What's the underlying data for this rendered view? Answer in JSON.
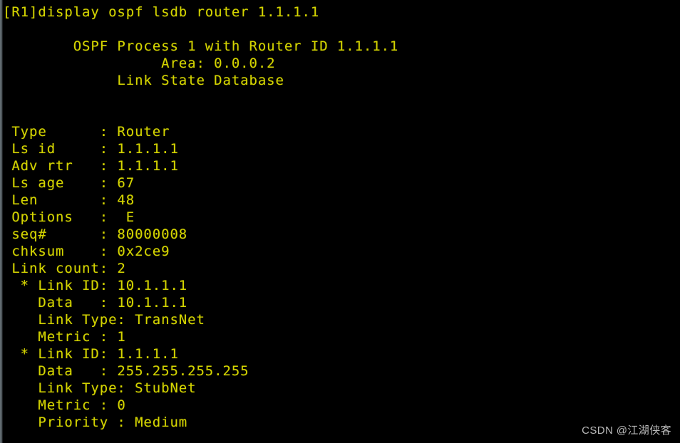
{
  "terminal": {
    "background_color": "#000000",
    "text_color": "#d4d400",
    "prompt_line": "[R1]display ospf lsdb router 1.1.1.1",
    "header": {
      "process_line": "OSPF Process 1 with Router ID 1.1.1.1",
      "area_line": "Area: 0.0.0.2",
      "database_line": "Link State Database"
    },
    "lsa": {
      "fields": [
        {
          "label": "Type",
          "separator": ":",
          "value": "Router"
        },
        {
          "label": "Ls id",
          "separator": ":",
          "value": "1.1.1.1"
        },
        {
          "label": "Adv rtr",
          "separator": ":",
          "value": "1.1.1.1"
        },
        {
          "label": "Ls age",
          "separator": ":",
          "value": "67"
        },
        {
          "label": "Len",
          "separator": ":",
          "value": "48"
        },
        {
          "label": "Options",
          "separator": ":",
          "value": "E"
        },
        {
          "label": "seq#",
          "separator": ":",
          "value": "80000008"
        },
        {
          "label": "chksum",
          "separator": ":",
          "value": "0x2ce9"
        },
        {
          "label": "Link count",
          "separator": ":",
          "value": "2"
        }
      ],
      "links": [
        {
          "marker": "*",
          "link_id_label": "Link ID",
          "link_id": "10.1.1.1",
          "data_label": "Data",
          "data": "10.1.1.1",
          "link_type_label": "Link Type",
          "link_type": "TransNet",
          "metric_label": "Metric",
          "metric": "1"
        },
        {
          "marker": "*",
          "link_id_label": "Link ID",
          "link_id": "1.1.1.1",
          "data_label": "Data",
          "data": "255.255.255.255",
          "link_type_label": "Link Type",
          "link_type": "StubNet",
          "metric_label": "Metric",
          "metric": "0",
          "priority_label": "Priority",
          "priority": "Medium"
        }
      ]
    },
    "raw_lines": [
      "[R1]display ospf lsdb router 1.1.1.1",
      "",
      "        OSPF Process 1 with Router ID 1.1.1.1",
      "                  Area: 0.0.0.2",
      "             Link State Database",
      "",
      "",
      " Type      : Router",
      " Ls id     : 1.1.1.1",
      " Adv rtr   : 1.1.1.1",
      " Ls age    : 67",
      " Len       : 48",
      " Options   :  E",
      " seq#      : 80000008",
      " chksum    : 0x2ce9",
      " Link count: 2",
      "  * Link ID: 10.1.1.1",
      "    Data   : 10.1.1.1",
      "    Link Type: TransNet",
      "    Metric : 1",
      "  * Link ID: 1.1.1.1",
      "    Data   : 255.255.255.255",
      "    Link Type: StubNet",
      "    Metric : 0",
      "    Priority : Medium"
    ]
  },
  "watermark": {
    "text": "CSDN @江湖侠客",
    "color": "#c9c9c9"
  }
}
